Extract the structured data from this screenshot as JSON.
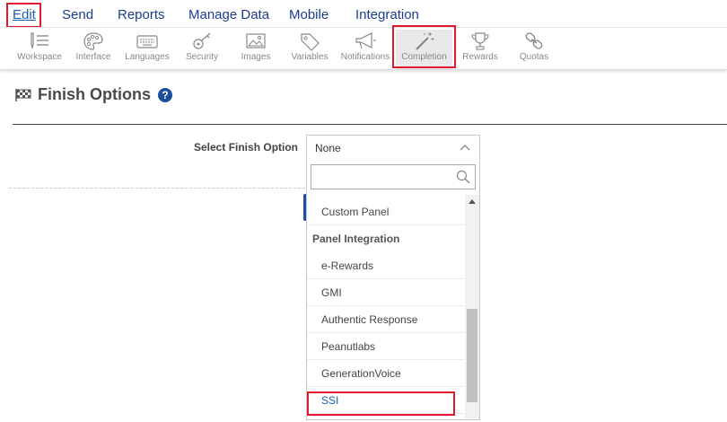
{
  "menu": {
    "items": [
      {
        "label": "Edit",
        "active": true
      },
      {
        "label": "Send"
      },
      {
        "label": "Reports"
      },
      {
        "label": "Manage Data"
      },
      {
        "label": "Mobile"
      },
      {
        "label": "Integration"
      }
    ]
  },
  "toolbar": {
    "items": [
      {
        "label": "Workspace",
        "icon": "workspace-icon"
      },
      {
        "label": "Interface",
        "icon": "palette-icon"
      },
      {
        "label": "Languages",
        "icon": "keyboard-icon"
      },
      {
        "label": "Security",
        "icon": "key-icon"
      },
      {
        "label": "Images",
        "icon": "image-icon"
      },
      {
        "label": "Variables",
        "icon": "tag-icon"
      },
      {
        "label": "Notifications",
        "icon": "megaphone-icon"
      },
      {
        "label": "Completion",
        "icon": "magic-wand-icon",
        "selected": true
      },
      {
        "label": "Rewards",
        "icon": "trophy-icon"
      },
      {
        "label": "Quotas",
        "icon": "chain-icon"
      }
    ]
  },
  "page": {
    "title": "Finish Options",
    "help": "?"
  },
  "finish": {
    "label": "Select Finish Option",
    "selected": "None",
    "search_value": "",
    "options": [
      {
        "label": "Custom Panel",
        "type": "option"
      },
      {
        "label": "Panel Integration",
        "type": "group"
      },
      {
        "label": "e-Rewards",
        "type": "option"
      },
      {
        "label": "GMI",
        "type": "option"
      },
      {
        "label": "Authentic Response",
        "type": "option"
      },
      {
        "label": "Peanutlabs",
        "type": "option"
      },
      {
        "label": "GenerationVoice",
        "type": "option"
      },
      {
        "label": "SSI",
        "type": "option",
        "selected": true
      }
    ]
  },
  "colors": {
    "accent": "#1a4f9c",
    "link": "#1a3d8f",
    "highlight": "#e0192e"
  }
}
